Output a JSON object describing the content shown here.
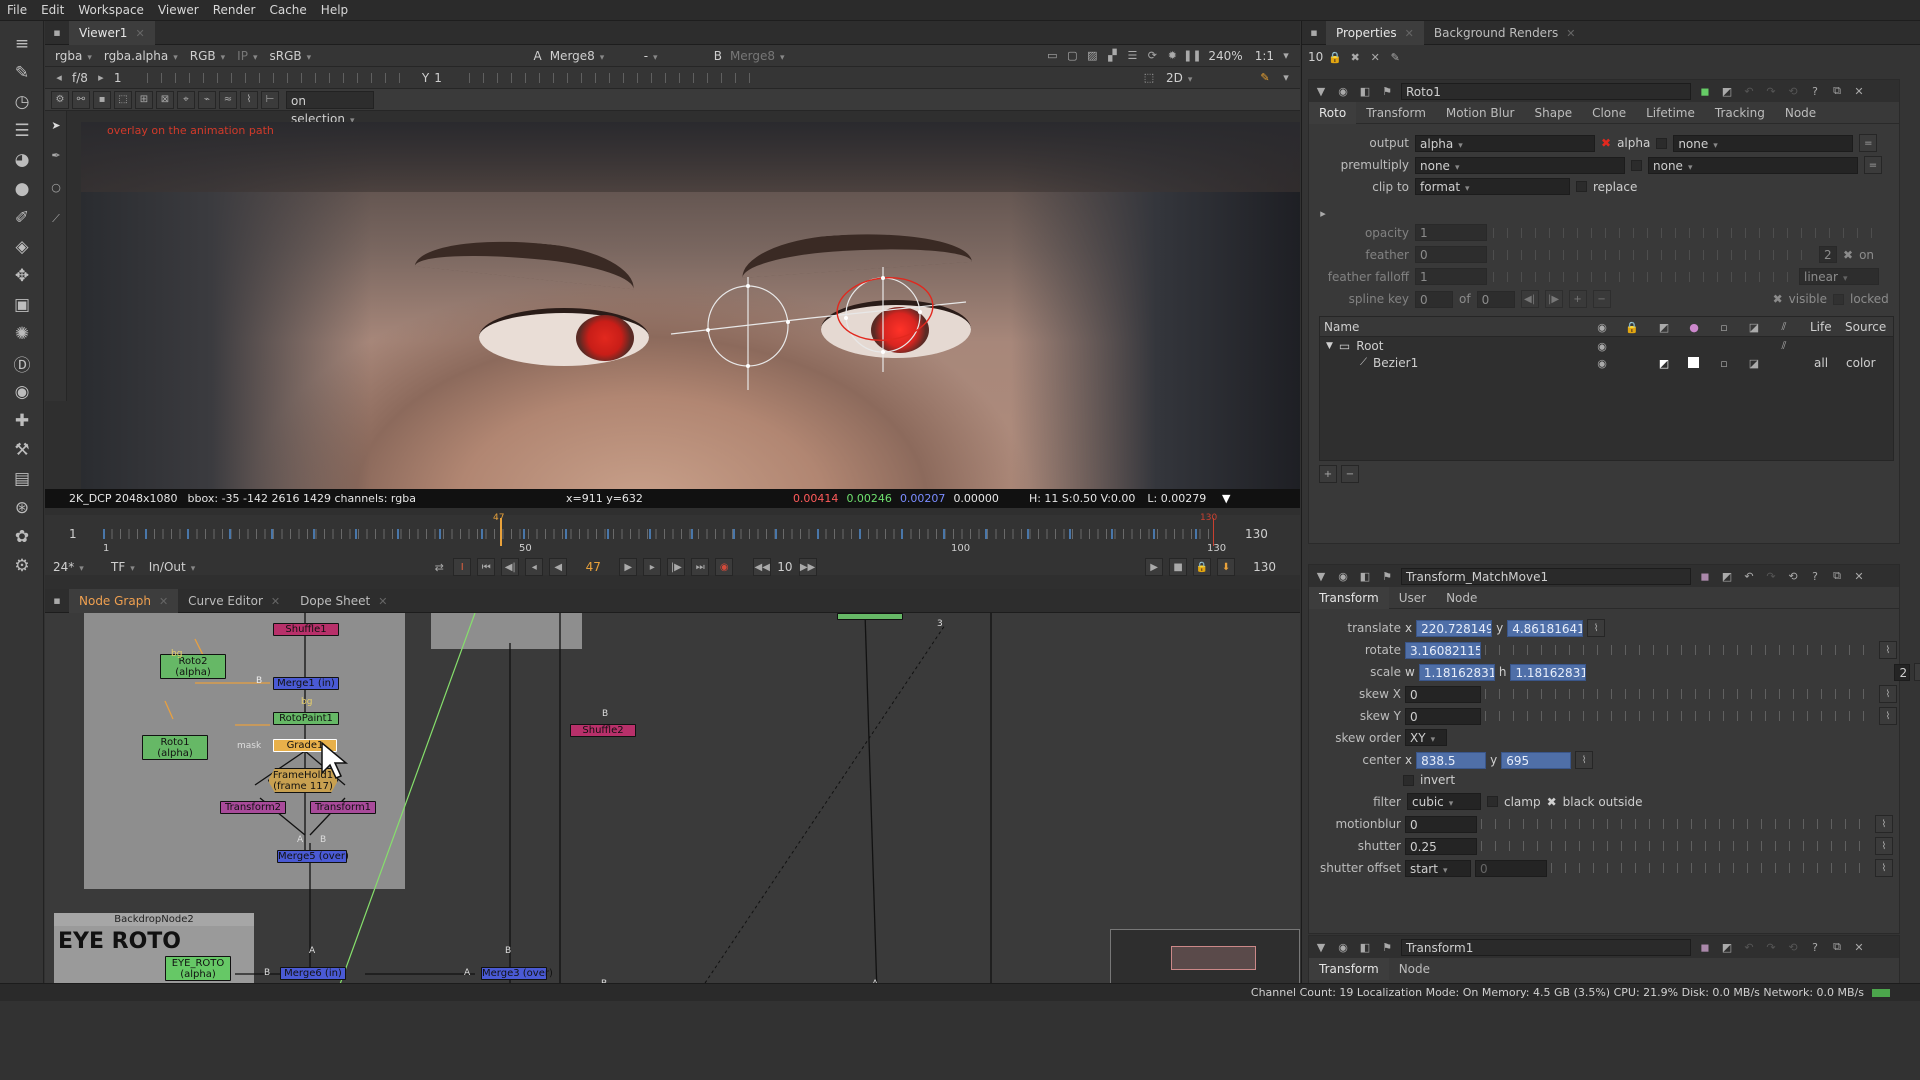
{
  "menu": [
    "File",
    "Edit",
    "Workspace",
    "Viewer",
    "Render",
    "Cache",
    "Help"
  ],
  "viewer": {
    "tab": "Viewer1",
    "channels": "rgba",
    "alpha": "rgba.alpha",
    "colorspace": "RGB",
    "ip": "IP",
    "lut": "sRGB",
    "a_label": "A",
    "a_input": "Merge8",
    "ab_mode": "-",
    "b_label": "B",
    "b_input": "Merge8",
    "zoom": "240%",
    "ratio": "1:1",
    "fstop": "f/8",
    "gain": "1",
    "y_label": "Y",
    "gamma": "1",
    "view_mode": "2D",
    "on_selection": "on selection",
    "overlay_note": "overlay on the animation path",
    "info_format": "2K_DCP 2048x1080",
    "info_bbox": "bbox: -35 -142 2616 1429 channels: rgba",
    "coords": "x=911 y=632",
    "pix_r": "0.00414",
    "pix_g": "0.00246",
    "pix_b": "0.00207",
    "pix_a": "0.00000",
    "hsv": "H: 11 S:0.50 V:0.00",
    "lum": "L: 0.00279",
    "red": "#e2281e"
  },
  "timeline": {
    "start": "1",
    "end": "130",
    "current": "47",
    "tick_50": "50",
    "tick_100": "100",
    "tick_130": "130",
    "frame_start": "1",
    "fps": "24*",
    "tf": "TF",
    "inout": "In/Out",
    "step": "10",
    "end2": "130"
  },
  "panels": {
    "bottom_tabs": [
      "Node Graph",
      "Curve Editor",
      "Dope Sheet"
    ],
    "nodes": {
      "shuffle1": "Shuffle1",
      "roto2": "Roto2",
      "roto2_sub": "(alpha)",
      "merge1": "Merge1 (in)",
      "rotopaint1": "RotoPaint1",
      "roto1": "Roto1",
      "roto1_sub": "(alpha)",
      "grade": "Grade1",
      "framehold": "FrameHold1",
      "framehold_sub": "(frame 117)",
      "transform2": "Transform2",
      "transform1": "Transform1",
      "merge5": "Merge5 (over)",
      "shuffle2": "Shuffle2",
      "backdrop": "BackdropNode2",
      "backdrop_title": "EYE ROTO",
      "eye_roto": "EYE_ROTO",
      "eye_roto_sub": "(alpha)",
      "merge6": "Merge6 (in)",
      "merge3": "Merge3 (over)",
      "mask": "mask",
      "bg": "bg",
      "b": "B",
      "a": "A",
      "three": "3"
    }
  },
  "properties": {
    "tabs": [
      "Properties",
      "Background Renders"
    ],
    "count": "10",
    "roto1": {
      "name": "Roto1",
      "tabs": [
        "Roto",
        "Transform",
        "Motion Blur",
        "Shape",
        "Clone",
        "Lifetime",
        "Tracking",
        "Node"
      ],
      "output_label": "output",
      "output": "alpha",
      "output_check": "alpha",
      "output_second": "none",
      "premultiply_label": "premultiply",
      "premultiply": "none",
      "premultiply_second": "none",
      "clip_to_label": "clip to",
      "clip_to": "format",
      "replace": "replace",
      "opacity_label": "opacity",
      "opacity": "1",
      "feather_label": "feather",
      "feather": "0",
      "feather_num": "2",
      "feather_on": "on",
      "falloff_label": "feather falloff",
      "falloff": "1",
      "falloff_mode": "linear",
      "splinekey_label": "spline key",
      "splinekey": "0",
      "of": "of",
      "of_val": "0",
      "visible": "visible",
      "locked": "locked",
      "tree_headers": [
        "Name",
        "Life",
        "Source"
      ],
      "tree": [
        {
          "name": "Root"
        },
        {
          "name": "Bezier1",
          "life": "all",
          "source": "color"
        }
      ]
    },
    "transform": {
      "name": "Transform_MatchMove1",
      "tabs": [
        "Transform",
        "User",
        "Node"
      ],
      "translate_label": "translate",
      "tx": "220.728149",
      "ty": "4.86181641",
      "rotate_label": "rotate",
      "rotate": "3.16082115",
      "scale_label": "scale",
      "sw": "1.18162831",
      "sh": "1.18162831",
      "scale_num": "2",
      "skewx_label": "skew X",
      "skewx": "0",
      "skewy_label": "skew Y",
      "skewy": "0",
      "skeworder_label": "skew order",
      "skeworder": "XY",
      "center_label": "center",
      "cx": "838.5",
      "cy": "695",
      "invert": "invert",
      "filter_label": "filter",
      "filter": "cubic",
      "clamp": "clamp",
      "black_outside": "black outside",
      "motionblur_label": "motionblur",
      "motionblur": "0",
      "shutter_label": "shutter",
      "shutter": "0.25",
      "shutteroffset_label": "shutter offset",
      "shutteroffset": "start",
      "shutteroffset_val": "0"
    },
    "transform1": {
      "name": "Transform1",
      "tabs": [
        "Transform",
        "Node"
      ]
    }
  },
  "status": "Channel Count: 19 Localization Mode: On Memory: 4.5 GB (3.5%) CPU: 21.9% Disk: 0.0 MB/s Network: 0.0 MB/s"
}
